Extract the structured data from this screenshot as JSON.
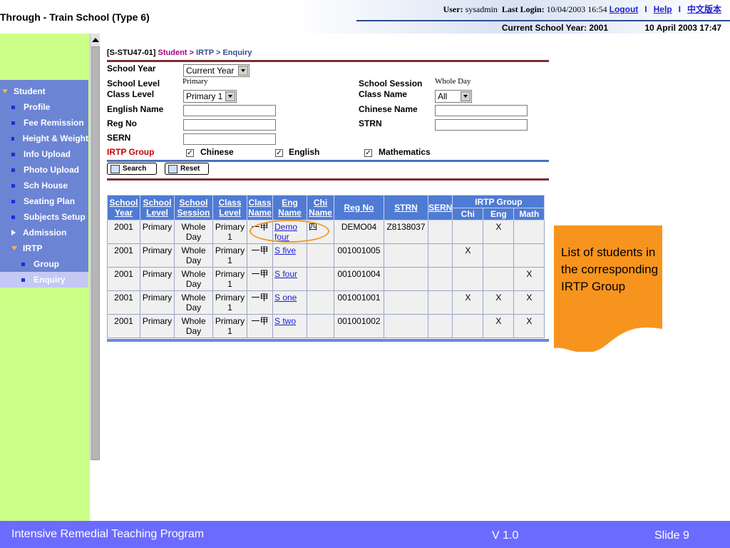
{
  "header": {
    "app_title": "Through - Train School (Type 6)",
    "user_label": "User:",
    "user": "sysadmin",
    "last_login_label": "Last Login:",
    "last_login": "10/04/2003 16:54",
    "logout": "Logout",
    "help": "Help",
    "chinese_version": "中文版本",
    "separator": "I",
    "current_school_year": "Current School Year: 2001",
    "datetime": "10 April 2003 17:47"
  },
  "sidebar": {
    "items": [
      {
        "label": "Student",
        "marker": "tri-down"
      },
      {
        "label": "Profile",
        "marker": "bullet"
      },
      {
        "label": "Fee Remission",
        "marker": "bullet"
      },
      {
        "label": "Height & Weight",
        "marker": "bullet"
      },
      {
        "label": "Info Upload",
        "marker": "bullet"
      },
      {
        "label": "Photo Upload",
        "marker": "bullet"
      },
      {
        "label": "Sch House",
        "marker": "bullet"
      },
      {
        "label": "Seating Plan",
        "marker": "bullet"
      },
      {
        "label": "Subjects Setup",
        "marker": "bullet"
      },
      {
        "label": "Admission",
        "marker": "tri-right"
      },
      {
        "label": "IRTP",
        "marker": "tri-down"
      },
      {
        "label": "Group",
        "marker": "bullet-sub"
      },
      {
        "label": "Enquiry",
        "marker": "bullet-sub",
        "selected": true
      }
    ]
  },
  "breadcrumb": {
    "code": "[S-STU47-01]",
    "student": "Student",
    "sep": ">",
    "rest": "IRTP > Enquiry"
  },
  "form": {
    "school_year_label": "School Year",
    "school_year_value": "Current Year",
    "school_level_label": "School Level",
    "school_level_value": "Primary",
    "school_session_label": "School Session",
    "school_session_value": "Whole Day",
    "class_level_label": "Class Level",
    "class_level_value": "Primary 1",
    "class_name_label": "Class Name",
    "class_name_value": "All",
    "english_name_label": "English Name",
    "chinese_name_label": "Chinese Name",
    "reg_no_label": "Reg No",
    "strn_label": "STRN",
    "sern_label": "SERN",
    "irtp_group_label": "IRTP Group",
    "chinese": "Chinese",
    "english": "English",
    "mathematics": "Mathematics",
    "check_mark": "✓",
    "search": "Search",
    "reset": "Reset"
  },
  "table": {
    "headers": {
      "school_year": "School Year",
      "school_level": "School Level",
      "school_session": "School Session",
      "class_level": "Class Level",
      "class_name": "Class Name",
      "eng_name": "Eng Name",
      "chi_name": "Chi Name",
      "reg_no": "Reg No",
      "strn": "STRN",
      "sern": "SERN",
      "irtp_group": "IRTP Group",
      "chi": "Chi",
      "eng": "Eng",
      "math": "Math"
    },
    "rows": [
      {
        "year": "2001",
        "level": "Primary",
        "session": "Whole Day",
        "class_level": "Primary 1",
        "class_name": "一甲",
        "eng_name": "Demo four",
        "chi_name": "四",
        "reg_no": "DEMO04",
        "strn": "Z8138037",
        "sern": "",
        "chi": "",
        "eng": "X",
        "math": ""
      },
      {
        "year": "2001",
        "level": "Primary",
        "session": "Whole Day",
        "class_level": "Primary 1",
        "class_name": "一甲",
        "eng_name": "S five",
        "chi_name": "",
        "reg_no": "001001005",
        "strn": "",
        "sern": "",
        "chi": "X",
        "eng": "",
        "math": ""
      },
      {
        "year": "2001",
        "level": "Primary",
        "session": "Whole Day",
        "class_level": "Primary 1",
        "class_name": "一甲",
        "eng_name": "S four",
        "chi_name": "",
        "reg_no": "001001004",
        "strn": "",
        "sern": "",
        "chi": "",
        "eng": "",
        "math": "X"
      },
      {
        "year": "2001",
        "level": "Primary",
        "session": "Whole Day",
        "class_level": "Primary 1",
        "class_name": "一甲",
        "eng_name": "S one",
        "chi_name": "",
        "reg_no": "001001001",
        "strn": "",
        "sern": "",
        "chi": "X",
        "eng": "X",
        "math": "X"
      },
      {
        "year": "2001",
        "level": "Primary",
        "session": "Whole Day",
        "class_level": "Primary 1",
        "class_name": "一甲",
        "eng_name": "S two",
        "chi_name": "",
        "reg_no": "001001002",
        "strn": "",
        "sern": "",
        "chi": "",
        "eng": "X",
        "math": "X"
      }
    ]
  },
  "callout": {
    "text": "List of students in the corresponding IRTP Group",
    "color": "#f7941d"
  },
  "footer": {
    "title": "Intensive Remedial Teaching Program",
    "version": "V 1.0",
    "slide": "Slide 9"
  }
}
